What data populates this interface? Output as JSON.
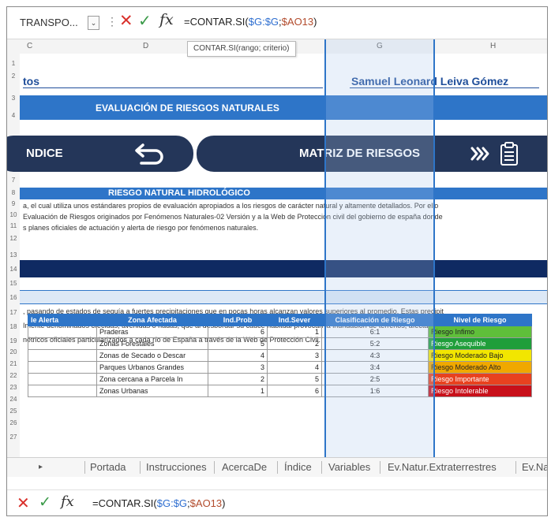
{
  "formula_bar": {
    "name_box": "TRANSPO...",
    "name_dropdown": "⌄",
    "more": "⋮",
    "cancel": "✕",
    "enter": "✓",
    "fx": "fx",
    "formula_prefix": "=CONTAR.SI(",
    "formula_ref1": "$G:$G",
    "formula_sep": ";",
    "formula_ref2": "$AO13",
    "formula_suffix": ")",
    "tooltip": "CONTAR.SI(rango; criterio)"
  },
  "columns": [
    "C",
    "D",
    "G",
    "H"
  ],
  "rows": [
    "1",
    "2",
    "3",
    "4",
    "5",
    "6",
    "7",
    "8",
    "9",
    "10",
    "11",
    "12",
    "13",
    "14",
    "15",
    "16",
    "17",
    "18",
    "19",
    "20",
    "21",
    "22",
    "23",
    "24",
    "25",
    "26",
    "27"
  ],
  "sheet": {
    "left_header": "tos",
    "author": "Samuel Leonard Leiva Gómez",
    "title": "EVALUACIÓN DE RIESGOS NATURALES",
    "nav_left": "NDICE",
    "nav_right": "MATRIZ DE RIESGOS",
    "section_title": "RIESGO NATURAL HIDROLÓGICO",
    "para1": [
      "a, el cual utiliza unos estándares propios de evaluación apropiados a los riesgos de carácter natural y altamente detallados. Por ello",
      "Evaluación de Riesgos originados por Fenómenos Naturales-02 Versión y a la Web de Protección civil del gobierno de españa donde",
      "s planes oficiales de actuación y alerta de riesgo por fenómenos naturales."
    ],
    "para2": [
      ", pasando de estados de sequía a fuertes precipitaciones que en pocas horas alcanzan valores superiores al promedio. Estas precipit",
      "Imente denominados crecidas, avenidas o riadas, que al desbordar su cauce habitual provocan la inundación de terrenos, afectando",
      "nétricos oficiales particularizados a cada río de España a través de la Web de Protección Civil."
    ]
  },
  "table": {
    "headers": [
      "le Alerta",
      "Zona Afectada",
      "Ind.Prob",
      "Ind.Sever",
      "Clasificación de Riesgo",
      "Nivel de Riesgo"
    ],
    "rows": [
      {
        "zona": "Praderas",
        "prob": "6",
        "sever": "1",
        "clas": "6:1",
        "nivel": "Riesgo Infimo",
        "color": "#5fbf3a"
      },
      {
        "zona": "Zonas Forestales",
        "prob": "5",
        "sever": "2",
        "clas": "5:2",
        "nivel": "Riesgo Asequible",
        "color": "#1f9e3a"
      },
      {
        "zona": "Zonas de Secado o Descar",
        "prob": "4",
        "sever": "3",
        "clas": "4:3",
        "nivel": "Riesgo Moderado Bajo",
        "color": "#f2e600"
      },
      {
        "zona": "Parques Urbanos Grandes",
        "prob": "3",
        "sever": "4",
        "clas": "3:4",
        "nivel": "Riesgo Moderado Alto",
        "color": "#f0a800"
      },
      {
        "zona": "Zona cercana a Parcela In",
        "prob": "2",
        "sever": "5",
        "clas": "2:5",
        "nivel": "Riesgo Importante",
        "color": "#e8421f"
      },
      {
        "zona": "Zonas Urbanas",
        "prob": "1",
        "sever": "6",
        "clas": "1:6",
        "nivel": "Riesgo Intolerable",
        "color": "#c8101a"
      }
    ]
  },
  "tabs": {
    "nav_arrow": "▸",
    "items": [
      "Portada",
      "Instrucciones",
      "AcercaDe",
      "Índice",
      "Variables",
      "Ev.Natur.Extraterrestres",
      "Ev.Na"
    ]
  },
  "bottom_bar": {
    "cancel": "✕",
    "enter": "✓",
    "fx": "fx",
    "formula_prefix": "=CONTAR.SI(",
    "formula_ref1": "$G:$G",
    "formula_sep": ";",
    "formula_ref2": "$AO13",
    "formula_suffix": ")"
  },
  "colors": {
    "accent_blue": "#2e75c8",
    "navy": "#0f2a62",
    "nav_button": "#243659"
  }
}
